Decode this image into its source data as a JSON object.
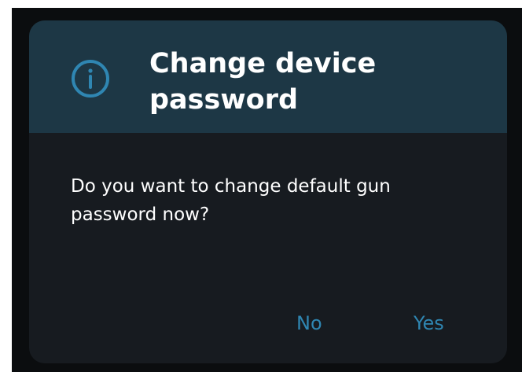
{
  "dialog": {
    "icon": "info-circle-icon",
    "title": "Change device password",
    "message": "Do you want to change default gun password now?",
    "no_label": "No",
    "yes_label": "Yes"
  },
  "colors": {
    "header_bg": "#1d3745",
    "body_bg": "#171b20",
    "accent": "#2f86b2",
    "text": "#ffffff"
  }
}
